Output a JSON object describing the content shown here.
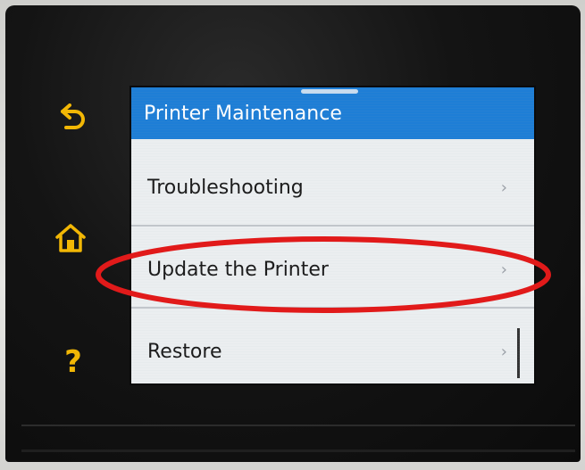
{
  "screen": {
    "title": "Printer Maintenance",
    "items": [
      {
        "label": "Troubleshooting",
        "chevron": "›"
      },
      {
        "label": "Update the Printer",
        "chevron": "›"
      },
      {
        "label": "Restore",
        "chevron": "›"
      }
    ]
  },
  "side_buttons": {
    "back": {
      "icon": "back-arrow-icon"
    },
    "home": {
      "icon": "home-icon"
    },
    "help": {
      "icon": "help-icon",
      "glyph": "?"
    }
  },
  "colors": {
    "title_bar": "#1e7ed6",
    "side_button": "#f2b705",
    "highlight_ring": "#e11a1a"
  }
}
